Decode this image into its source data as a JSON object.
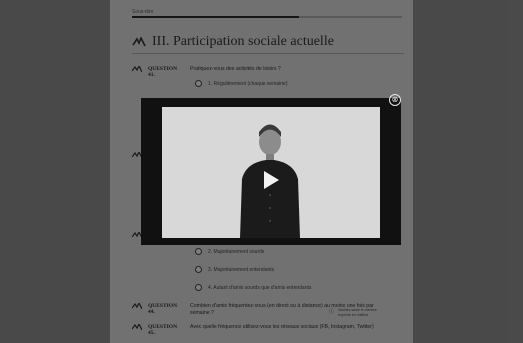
{
  "progress": {
    "label": "Sous-titre",
    "value": 0.62
  },
  "section": {
    "title": "III. Participation sociale actuelle"
  },
  "questions": [
    {
      "number": "QUESTION 41.",
      "text": "Pratiquez-vous des activités de loisirs ?",
      "options": [
        "1. Régulièrement (chaque semaine)"
      ]
    },
    {
      "number": "QUESTION 44.",
      "text": "Combien d'amis fréquentez-vous (en direct ou à distance) au moins une fois par semaine ?"
    },
    {
      "number": "QUESTION 45.",
      "text": "Avec quelle fréquence utilisez-vous les réseaux sociaux (FB, Instagram, Twitter)"
    }
  ],
  "options_mid": [
    "2. Majoritairement sourds",
    "3. Majoritairement entendants",
    "4. Autant d'amis sourds que d'amis entendants"
  ],
  "aside_text": "Veuillez saisir le nombre exprimé en chiffres",
  "modal": {
    "close_label": "⊗"
  },
  "icons": {
    "question": "hand-sign-icon",
    "close": "close-circle-icon",
    "play": "play-icon"
  }
}
